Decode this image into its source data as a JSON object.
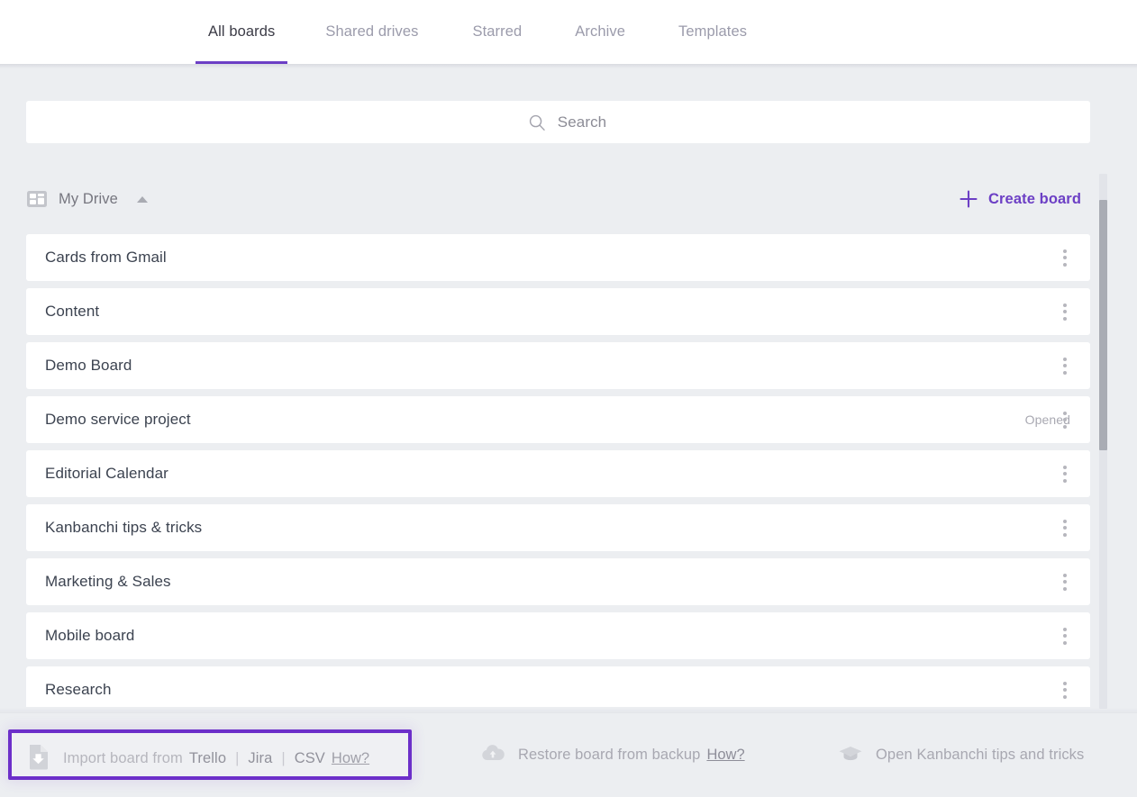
{
  "tabs": [
    {
      "label": "All boards",
      "active": true
    },
    {
      "label": "Shared drives",
      "active": false
    },
    {
      "label": "Starred",
      "active": false
    },
    {
      "label": "Archive",
      "active": false
    },
    {
      "label": "Templates",
      "active": false
    }
  ],
  "search": {
    "placeholder": "Search",
    "value": "",
    "icon": "search-icon"
  },
  "drive": {
    "label": "My Drive",
    "icon": "board-grid-icon",
    "collapse_icon": "triangle-up-icon",
    "create_board_label": "Create board",
    "create_board_icon": "plus-icon"
  },
  "boards": [
    {
      "name": "Cards from Gmail",
      "meta": ""
    },
    {
      "name": "Content",
      "meta": ""
    },
    {
      "name": "Demo Board",
      "meta": ""
    },
    {
      "name": "Demo service project",
      "meta": "Opened"
    },
    {
      "name": "Editorial Calendar",
      "meta": ""
    },
    {
      "name": "Kanbanchi tips & tricks",
      "meta": ""
    },
    {
      "name": "Marketing & Sales",
      "meta": ""
    },
    {
      "name": "Mobile board",
      "meta": ""
    },
    {
      "name": "Research",
      "meta": ""
    }
  ],
  "bottom": {
    "import": {
      "icon": "file-import-icon",
      "prefix": "Import board from",
      "sources": [
        "Trello",
        "Jira",
        "CSV"
      ],
      "separator": "|",
      "how_label": "How?"
    },
    "restore": {
      "icon": "cloud-upload-icon",
      "label": "Restore board from backup",
      "how_label": "How?"
    },
    "tips": {
      "icon": "graduation-cap-icon",
      "label": "Open Kanbanchi tips and tricks"
    }
  },
  "colors": {
    "accent_purple": "#6c3fc5",
    "highlight_purple": "#6c2fc9",
    "page_bg": "#eceef1",
    "card_bg": "#ffffff",
    "text_primary": "#3c4350",
    "text_muted": "#a8a8b1"
  }
}
